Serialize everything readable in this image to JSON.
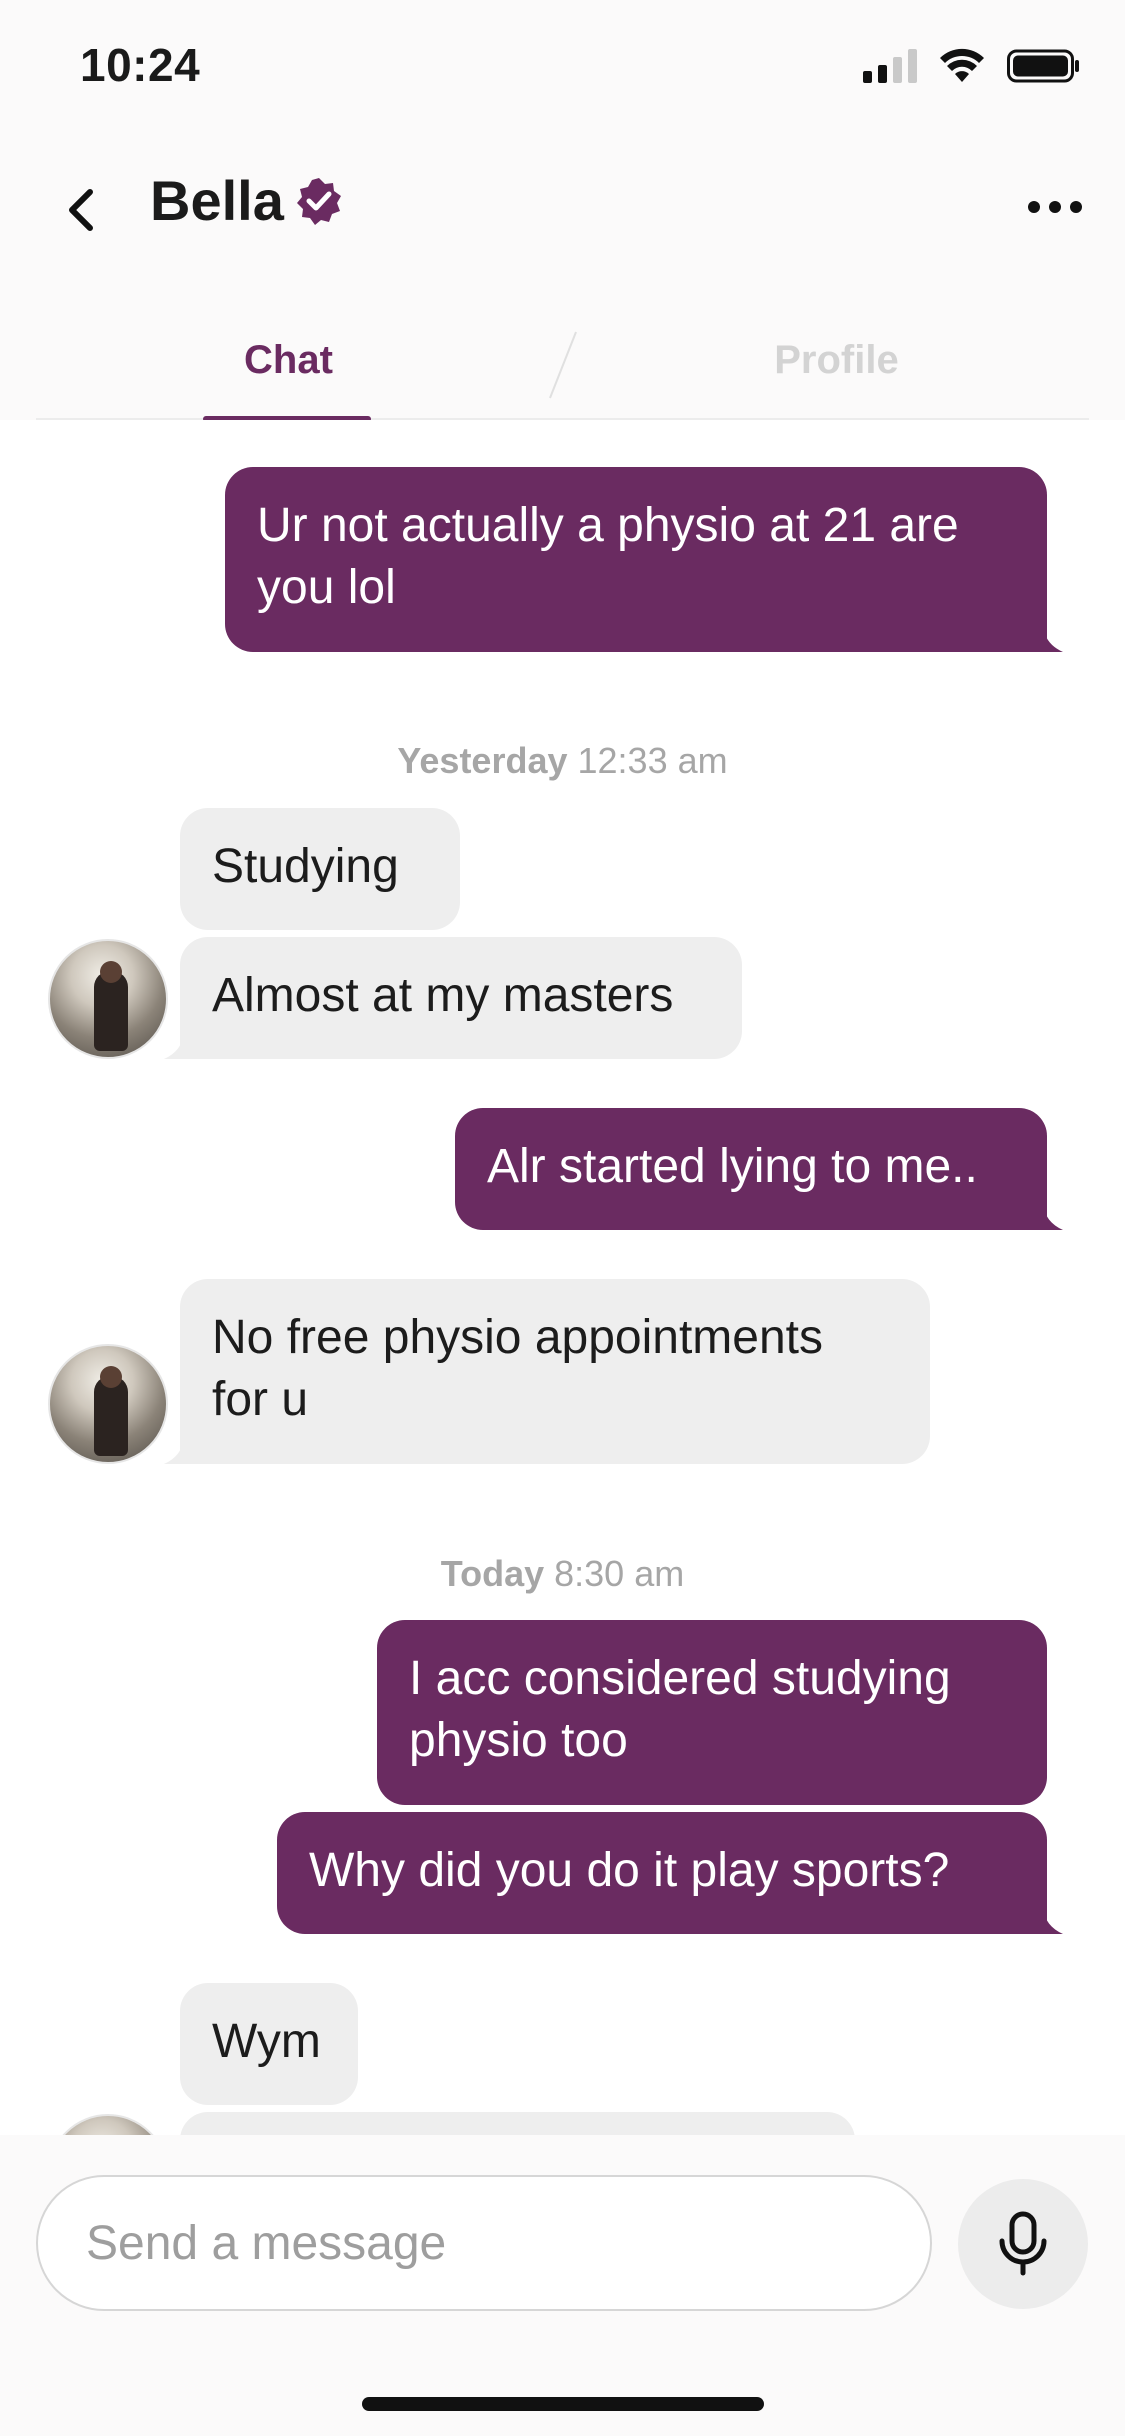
{
  "status": {
    "time": "10:24"
  },
  "header": {
    "name": "Bella"
  },
  "tabs": [
    {
      "label": "Chat",
      "active": true
    },
    {
      "label": "Profile",
      "active": false
    }
  ],
  "messages": [
    {
      "from": "me",
      "lines": [
        "Ur not actually a physio at 21 are",
        "you lol"
      ]
    },
    {
      "timestamp_day": "Yesterday",
      "timestamp_time": "12:33 am"
    },
    {
      "from": "her",
      "lines": [
        "Studying"
      ]
    },
    {
      "from": "her",
      "lines": [
        "Almost at my masters"
      ]
    },
    {
      "from": "me",
      "lines": [
        "Alr started lying to me.."
      ]
    },
    {
      "from": "her",
      "lines": [
        "No free physio appointments",
        "for u"
      ]
    },
    {
      "timestamp_day": "Today",
      "timestamp_time": "8:30 am"
    },
    {
      "from": "me",
      "lines": [
        "I acc considered studying",
        "physio too"
      ]
    },
    {
      "from": "me",
      "lines": [
        "Why did you do it play sports?"
      ]
    },
    {
      "from": "her",
      "lines": [
        "Wym"
      ]
    }
  ],
  "composer": {
    "placeholder": "Send a message"
  },
  "colors": {
    "accent": "#6a2b61",
    "incoming_bubble": "#eeeeee",
    "inactive_tab": "#d3d3d3"
  }
}
